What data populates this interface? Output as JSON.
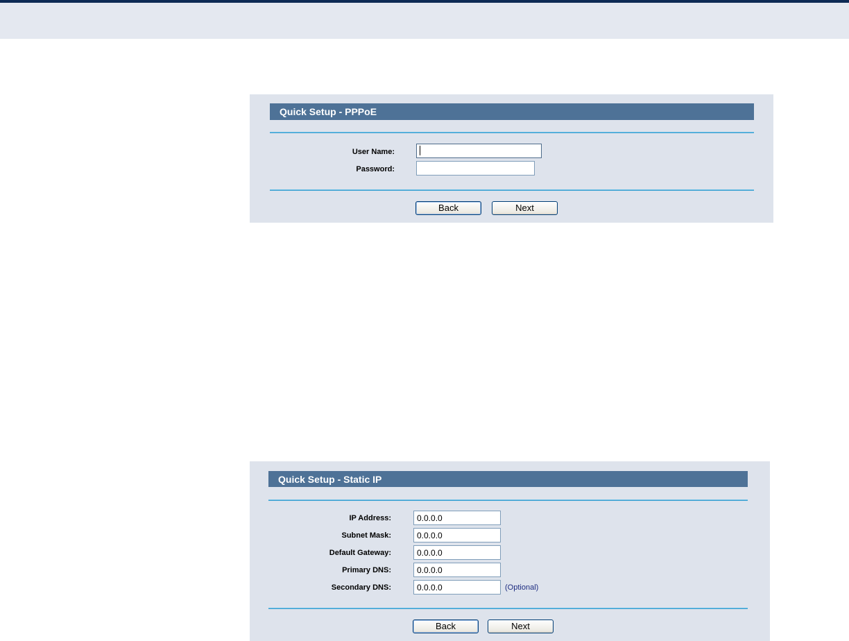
{
  "pppoe_panel": {
    "title": "Quick Setup - PPPoE",
    "fields": {
      "user_name": {
        "label": "User Name:",
        "value": ""
      },
      "password": {
        "label": "Password:",
        "value": ""
      }
    },
    "buttons": {
      "back": "Back",
      "next": "Next"
    }
  },
  "static_ip_panel": {
    "title": "Quick Setup - Static IP",
    "fields": {
      "ip_address": {
        "label": "IP Address:",
        "value": "0.0.0.0"
      },
      "subnet_mask": {
        "label": "Subnet Mask:",
        "value": "0.0.0.0"
      },
      "default_gateway": {
        "label": "Default Gateway:",
        "value": "0.0.0.0"
      },
      "primary_dns": {
        "label": "Primary DNS:",
        "value": "0.0.0.0"
      },
      "secondary_dns": {
        "label": "Secondary DNS:",
        "value": "0.0.0.0",
        "hint": "(Optional)"
      }
    },
    "buttons": {
      "back": "Back",
      "next": "Next"
    }
  },
  "colors": {
    "title_bar": "#4e7297",
    "panel_background": "#dee3ec",
    "rule": "#3a9fd0",
    "header_band": "#e4e8f0"
  }
}
